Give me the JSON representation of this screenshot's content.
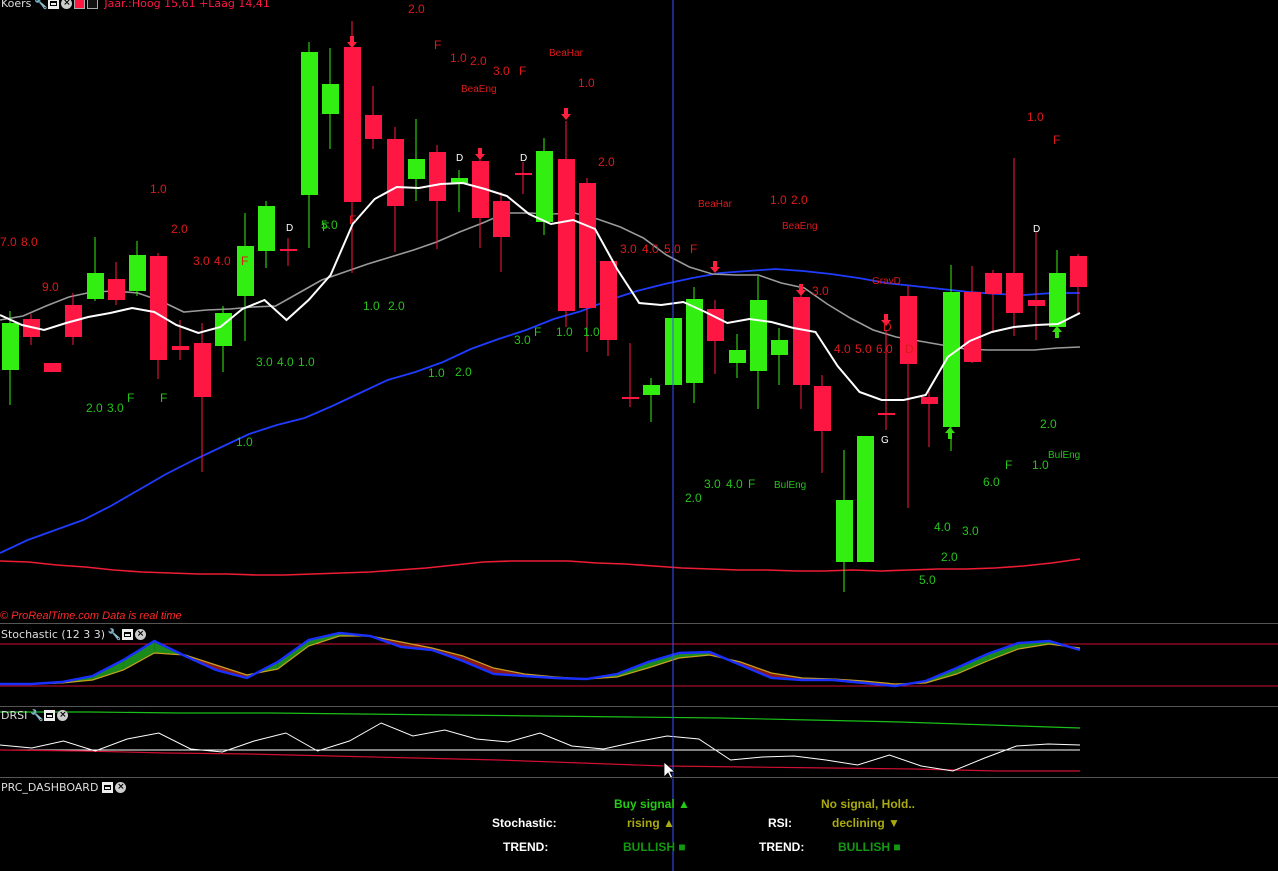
{
  "panels": {
    "price": {
      "title": "Koers",
      "info": "Jaar.:Hoog 15,61 +Laag 14,41"
    },
    "stochastic": {
      "title": "Stochastic (12 3 3)"
    },
    "drsi": {
      "title": "DRSI"
    },
    "dashboard": {
      "title": "PRC_DASHBOARD"
    }
  },
  "copyright": "© ProRealTime.com  Data is real time",
  "dashboard": {
    "stoch_label": "Stochastic:",
    "stoch_signal": "Buy signal ▲",
    "stoch_dir": "rising ▲",
    "trend_label": "TREND:",
    "trend_left": "BULLISH ■",
    "rsi_label": "RSI:",
    "rsi_signal": "No signal, Hold..",
    "rsi_dir": "declining ▼",
    "trend_right": "BULLISH ■"
  },
  "colors": {
    "bull": "#33ee11",
    "bear": "#ff1744",
    "ma_short": "#ffffff",
    "ma_mid": "#9a9a9a",
    "ma_long": "#1f3cff",
    "ma_vlong": "#ee1c34",
    "cursor": "#3a50ff"
  },
  "chart_data": {
    "type": "candlestick",
    "candles": [
      {
        "o": 370,
        "c": 323,
        "h": 311,
        "l": 405
      },
      {
        "o": 319,
        "c": 337,
        "h": 314,
        "l": 345
      },
      {
        "o": 363,
        "c": 372,
        "h": 363,
        "l": 372
      },
      {
        "o": 305,
        "c": 337,
        "h": 293,
        "l": 345
      },
      {
        "o": 299,
        "c": 273,
        "h": 237,
        "l": 301
      },
      {
        "o": 279,
        "c": 300,
        "h": 262,
        "l": 305
      },
      {
        "o": 291,
        "c": 255,
        "h": 241,
        "l": 296
      },
      {
        "o": 256,
        "c": 360,
        "h": 253,
        "l": 379
      },
      {
        "o": 346,
        "c": 350,
        "h": 320,
        "l": 360
      },
      {
        "o": 343,
        "c": 397,
        "h": 323,
        "l": 472
      },
      {
        "o": 346,
        "c": 313,
        "h": 306,
        "l": 372
      },
      {
        "o": 296,
        "c": 246,
        "h": 213,
        "l": 341
      },
      {
        "o": 251,
        "c": 206,
        "h": 201,
        "l": 268
      },
      {
        "o": 249,
        "c": 249,
        "h": 238,
        "l": 266
      },
      {
        "o": 195,
        "c": 52,
        "h": 42,
        "l": 248
      },
      {
        "o": 114,
        "c": 84,
        "h": 48,
        "l": 149
      },
      {
        "o": 47,
        "c": 202,
        "h": 21,
        "l": 273
      },
      {
        "o": 115,
        "c": 139,
        "h": 86,
        "l": 149
      },
      {
        "o": 139,
        "c": 206,
        "h": 127,
        "l": 252
      },
      {
        "o": 179,
        "c": 159,
        "h": 119,
        "l": 201
      },
      {
        "o": 152,
        "c": 201,
        "h": 145,
        "l": 249
      },
      {
        "o": 183,
        "c": 178,
        "h": 170,
        "l": 212
      },
      {
        "o": 161,
        "c": 218,
        "h": 156,
        "l": 248
      },
      {
        "o": 201,
        "c": 237,
        "h": 192,
        "l": 272
      },
      {
        "o": 173,
        "c": 173,
        "h": 162,
        "l": 194
      },
      {
        "o": 222,
        "c": 151,
        "h": 138,
        "l": 235
      },
      {
        "o": 159,
        "c": 311,
        "h": 121,
        "l": 327
      },
      {
        "o": 183,
        "c": 308,
        "h": 178,
        "l": 352
      },
      {
        "o": 261,
        "c": 340,
        "h": 261,
        "l": 356
      },
      {
        "o": 397,
        "c": 397,
        "h": 343,
        "l": 407
      },
      {
        "o": 395,
        "c": 385,
        "h": 378,
        "l": 422
      },
      {
        "o": 385,
        "c": 318,
        "h": 301,
        "l": 409
      },
      {
        "o": 383,
        "c": 299,
        "h": 287,
        "l": 403
      },
      {
        "o": 309,
        "c": 341,
        "h": 300,
        "l": 374
      },
      {
        "o": 363,
        "c": 350,
        "h": 334,
        "l": 378
      },
      {
        "o": 371,
        "c": 300,
        "h": 276,
        "l": 409
      },
      {
        "o": 355,
        "c": 340,
        "h": 328,
        "l": 385
      },
      {
        "o": 297,
        "c": 385,
        "h": 284,
        "l": 409
      },
      {
        "o": 386,
        "c": 431,
        "h": 375,
        "l": 473
      },
      {
        "o": 562,
        "c": 500,
        "h": 450,
        "l": 592
      },
      {
        "o": 562,
        "c": 436,
        "h": 436,
        "l": 562
      },
      {
        "o": 413,
        "c": 413,
        "h": 330,
        "l": 430
      },
      {
        "o": 296,
        "c": 364,
        "h": 286,
        "l": 508
      },
      {
        "o": 397,
        "c": 404,
        "h": 390,
        "l": 447
      },
      {
        "o": 427,
        "c": 292,
        "h": 265,
        "l": 451
      },
      {
        "o": 292,
        "c": 362,
        "h": 266,
        "l": 363
      },
      {
        "o": 273,
        "c": 294,
        "h": 270,
        "l": 333
      },
      {
        "o": 273,
        "c": 313,
        "h": 158,
        "l": 336
      },
      {
        "o": 300,
        "c": 306,
        "h": 232,
        "l": 340
      },
      {
        "o": 327,
        "c": 273,
        "h": 250,
        "l": 328
      },
      {
        "o": 256,
        "c": 287,
        "h": 254,
        "l": 315
      }
    ],
    "ma_short": [
      315,
      325,
      330,
      323,
      317,
      313,
      308,
      312,
      325,
      333,
      327,
      309,
      300,
      320,
      300,
      275,
      224,
      199,
      187,
      188,
      184,
      183,
      189,
      196,
      214,
      224,
      220,
      229,
      269,
      303,
      305,
      302,
      312,
      323,
      319,
      322,
      328,
      332,
      366,
      392,
      400,
      400,
      395,
      357,
      341,
      332,
      327,
      325,
      324,
      313
    ],
    "ma_mid": [
      320,
      316,
      306,
      297,
      292,
      291,
      293,
      301,
      312,
      310,
      309,
      307,
      306,
      293,
      280,
      272,
      264,
      257,
      250,
      242,
      232,
      223,
      213,
      213,
      214,
      213,
      219,
      227,
      238,
      255,
      267,
      274,
      275,
      275,
      283,
      288,
      304,
      318,
      330,
      337,
      341,
      345,
      349,
      350,
      350,
      350,
      348,
      347
    ],
    "ma_long": [
      553,
      540,
      530,
      520,
      506,
      490,
      474,
      460,
      447,
      434,
      425,
      418,
      406,
      393,
      380,
      372,
      362,
      349,
      339,
      330,
      319,
      311,
      300,
      291,
      284,
      278,
      273,
      271,
      269,
      271,
      274,
      278,
      283,
      286,
      289,
      292,
      294,
      295,
      293,
      293
    ],
    "ma_vlong": [
      561,
      562,
      565,
      567,
      570,
      572,
      573,
      574,
      574,
      575,
      575,
      574,
      573,
      572,
      570,
      568,
      565,
      562,
      561,
      561,
      561,
      563,
      564,
      566,
      568,
      569,
      570,
      570,
      571,
      571,
      570,
      571,
      570,
      569,
      569,
      568,
      566,
      563,
      559
    ],
    "labels": [
      {
        "t": "2.0",
        "c": "bear"
      },
      {
        "t": "F",
        "c": "bear"
      },
      {
        "t": "1.0",
        "c": "bear"
      },
      {
        "t": "2.0",
        "c": "bear"
      },
      {
        "t": "3.0",
        "c": "bear"
      },
      {
        "t": "F",
        "c": "bear"
      },
      {
        "t": "BeaEng",
        "c": "bear"
      },
      {
        "t": "BeaHar",
        "c": "bear"
      },
      {
        "t": "1.0",
        "c": "bear"
      },
      {
        "t": "2.0",
        "c": "bear"
      },
      {
        "t": "1.0",
        "c": "bear"
      },
      {
        "t": "2.0",
        "c": "bear"
      },
      {
        "t": "7.0",
        "c": "bear"
      },
      {
        "t": "8.0",
        "c": "bear"
      },
      {
        "t": "9.0",
        "c": "bear"
      },
      {
        "t": "3.0",
        "c": "bear"
      },
      {
        "t": "4.0",
        "c": "bear"
      },
      {
        "t": "F",
        "c": "bear"
      },
      {
        "t": "D",
        "c": "white"
      },
      {
        "t": "D",
        "c": "white"
      },
      {
        "t": "D",
        "c": "white"
      },
      {
        "t": "5.0",
        "c": "bull"
      },
      {
        "t": "F",
        "c": "bear"
      },
      {
        "t": "3.0",
        "c": "bear"
      },
      {
        "t": "4.0",
        "c": "bear"
      },
      {
        "t": "5.0",
        "c": "bear"
      },
      {
        "t": "F",
        "c": "bear"
      },
      {
        "t": "BeaHar",
        "c": "bear"
      },
      {
        "t": "1.0",
        "c": "bear"
      },
      {
        "t": "2.0",
        "c": "bear"
      },
      {
        "t": "BeaEng",
        "c": "bear"
      },
      {
        "t": "3.0",
        "c": "bear"
      },
      {
        "t": "GravD",
        "c": "bear"
      },
      {
        "t": "4.0",
        "c": "bear"
      },
      {
        "t": "5.0",
        "c": "bear"
      },
      {
        "t": "6.0",
        "c": "bear"
      },
      {
        "t": "D",
        "c": "bear"
      },
      {
        "t": "D",
        "c": "bear"
      },
      {
        "t": "1.0",
        "c": "bear"
      },
      {
        "t": "F",
        "c": "bear"
      },
      {
        "t": "D",
        "c": "white"
      },
      {
        "t": "G",
        "c": "white"
      },
      {
        "t": "1.0",
        "c": "bull"
      },
      {
        "t": "F",
        "c": "bull"
      },
      {
        "t": "2.0",
        "c": "bull"
      },
      {
        "t": "3.0",
        "c": "bull"
      },
      {
        "t": "F",
        "c": "bull"
      },
      {
        "t": "1.0",
        "c": "bull"
      },
      {
        "t": "2.0",
        "c": "bull"
      },
      {
        "t": "3.0",
        "c": "bull"
      },
      {
        "t": "4.0",
        "c": "bull"
      },
      {
        "t": "1.0",
        "c": "bull"
      },
      {
        "t": "F",
        "c": "bull"
      },
      {
        "t": "1.0",
        "c": "bull"
      },
      {
        "t": "2.0",
        "c": "bull"
      },
      {
        "t": "3.0",
        "c": "bull"
      },
      {
        "t": "F",
        "c": "bull"
      },
      {
        "t": "1.0",
        "c": "bull"
      },
      {
        "t": "1.0",
        "c": "bull"
      },
      {
        "t": "2.0",
        "c": "bull"
      },
      {
        "t": "3.0",
        "c": "bull"
      },
      {
        "t": "4.0",
        "c": "bull"
      },
      {
        "t": "F",
        "c": "bull"
      },
      {
        "t": "BulEng",
        "c": "bull"
      },
      {
        "t": "4.0",
        "c": "bull"
      },
      {
        "t": "3.0",
        "c": "bull"
      },
      {
        "t": "2.0",
        "c": "bull"
      },
      {
        "t": "5.0",
        "c": "bull"
      },
      {
        "t": "6.0",
        "c": "bull"
      },
      {
        "t": "F",
        "c": "bull"
      },
      {
        "t": "1.0",
        "c": "bull"
      },
      {
        "t": "BulEng",
        "c": "bull"
      },
      {
        "t": "2.0",
        "c": "bull"
      }
    ],
    "stoch_k": [
      684,
      684,
      682,
      676,
      660,
      641,
      656,
      670,
      678,
      662,
      640,
      633,
      636,
      647,
      650,
      661,
      674,
      676,
      678,
      679,
      674,
      662,
      653,
      652,
      665,
      678,
      680,
      680,
      683,
      686,
      681,
      668,
      654,
      643,
      641,
      650
    ],
    "stoch_d": [
      684,
      684,
      683,
      680,
      670,
      653,
      655,
      665,
      675,
      669,
      646,
      636,
      636,
      642,
      648,
      656,
      668,
      674,
      677,
      679,
      677,
      668,
      658,
      655,
      662,
      673,
      678,
      679,
      681,
      684,
      683,
      674,
      661,
      649,
      644,
      648
    ],
    "drsi_line": [
      745,
      748,
      741,
      751,
      739,
      733,
      749,
      752,
      741,
      733,
      751,
      741,
      723,
      736,
      730,
      739,
      742,
      733,
      746,
      749,
      742,
      736,
      739,
      760,
      757,
      756,
      760,
      765,
      755,
      766,
      771,
      758,
      746,
      744,
      745
    ],
    "drsi_upper": [
      712,
      712,
      713,
      713,
      714,
      715,
      716,
      717,
      718,
      720,
      722,
      725,
      728
    ],
    "drsi_lower": [
      750,
      751,
      753,
      754,
      756,
      758,
      760,
      763,
      766,
      767,
      768,
      769,
      771,
      771
    ]
  }
}
